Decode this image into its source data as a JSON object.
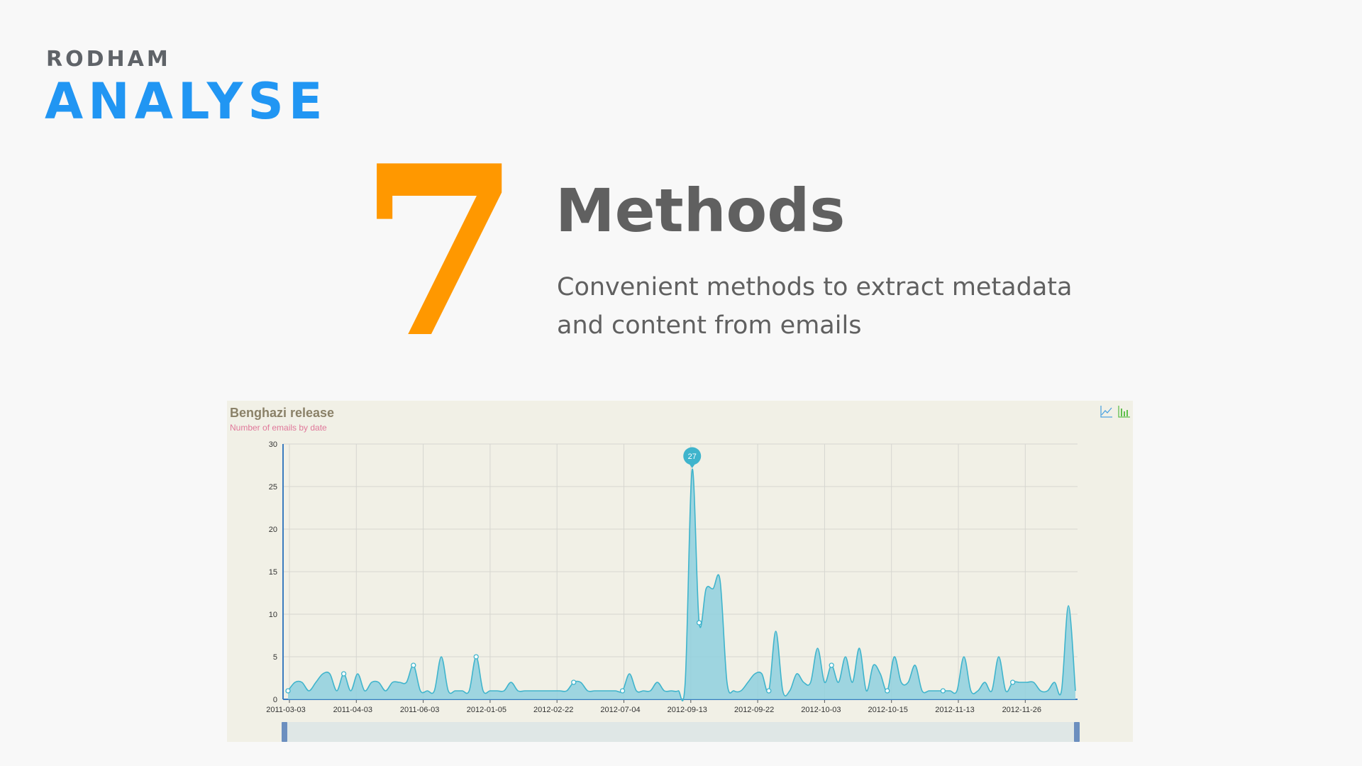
{
  "brand": {
    "top": "RODHAM",
    "main": "ANALYSE"
  },
  "feature": {
    "number": "7",
    "title": "Methods",
    "description": "Convenient methods to extract metadata and content from emails"
  },
  "colors": {
    "brand_blue": "#2196f3",
    "number_orange": "#ff9800",
    "text_gray": "#606060",
    "series": "#3fb4cc",
    "chart_bg": "#f1f0e6"
  },
  "chart_toolbar": {
    "icons": [
      "line-chart-icon",
      "bar-chart-icon"
    ]
  },
  "chart_data": {
    "type": "area",
    "title": "Benghazi release",
    "subtitle": "Number of emails by date",
    "xlabel": "",
    "ylabel": "",
    "ylim": [
      0,
      30
    ],
    "y_ticks": [
      0,
      5,
      10,
      15,
      20,
      25,
      30
    ],
    "x_tick_labels": [
      "2011-03-03",
      "2011-04-03",
      "2011-06-03",
      "2012-01-05",
      "2012-02-22",
      "2012-07-04",
      "2012-09-13",
      "2012-09-22",
      "2012-10-03",
      "2012-10-15",
      "2012-11-13",
      "2012-11-26"
    ],
    "grid": true,
    "legend": "none",
    "max_label": "27",
    "series": [
      {
        "values": [
          1,
          2,
          2,
          1,
          2,
          3,
          3,
          1,
          3,
          1,
          3,
          1,
          2,
          2,
          1,
          2,
          2,
          2,
          4,
          1,
          1,
          1,
          5,
          1,
          1,
          1,
          1,
          5,
          1,
          1,
          1,
          1,
          2,
          1,
          1,
          1,
          1,
          1,
          1,
          1,
          1,
          2,
          2,
          1,
          1,
          1,
          1,
          1,
          1,
          3,
          1,
          1,
          1,
          2,
          1,
          1,
          1,
          2,
          27,
          9,
          13,
          13,
          14,
          2,
          1,
          1,
          2,
          3,
          3,
          1,
          8,
          1,
          1,
          3,
          2,
          2,
          6,
          2,
          4,
          2,
          5,
          2,
          6,
          1,
          4,
          3,
          1,
          5,
          2,
          2,
          4,
          1,
          1,
          1,
          1,
          1,
          1,
          5,
          1,
          1,
          2,
          1,
          5,
          1,
          2,
          2,
          2,
          2,
          1,
          1,
          2,
          1,
          11,
          1
        ]
      }
    ]
  }
}
